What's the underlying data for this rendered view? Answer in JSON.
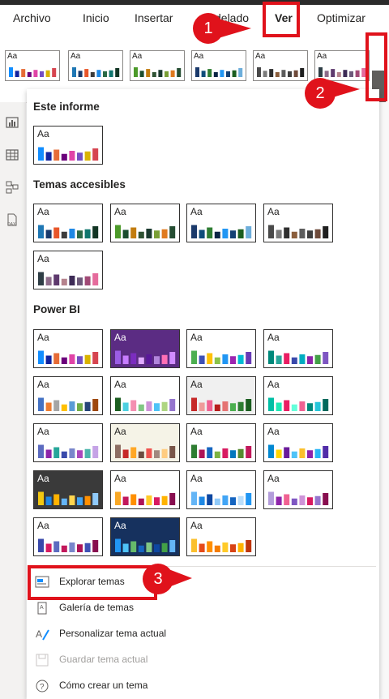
{
  "ribbon_tabs": [
    {
      "label": "Archivo"
    },
    {
      "label": "Inicio"
    },
    {
      "label": "Insertar"
    },
    {
      "label": "delado"
    },
    {
      "label": "Ver"
    },
    {
      "label": "Optimizar"
    }
  ],
  "theme_thumb_text": "Aa",
  "sections": {
    "este_informe": "Este informe",
    "temas_accesibles": "Temas accesibles",
    "power_bi": "Power BI"
  },
  "menu_items": [
    {
      "label": "Explorar temas",
      "icon": "browse-themes-icon",
      "enabled": true
    },
    {
      "label": "Galería de temas",
      "icon": "theme-gallery-icon",
      "enabled": true
    },
    {
      "label": "Personalizar tema actual",
      "icon": "customize-theme-icon",
      "enabled": true
    },
    {
      "label": "Guardar tema actual",
      "icon": "save-theme-icon",
      "enabled": false
    },
    {
      "label": "Cómo crear un tema",
      "icon": "help-icon",
      "enabled": true
    }
  ],
  "callouts": [
    "1",
    "2",
    "3"
  ],
  "colors": {
    "accent_tab": "#1b6e63",
    "callout_red": "#e0121b",
    "ribbon_dark": "#2b2b2b"
  },
  "themes": [
    {
      "group": "este_informe",
      "bg": "#ffffff",
      "dark": false,
      "bars": [
        "#118DFF",
        "#12239E",
        "#E66C37",
        "#6B007B",
        "#E044A7",
        "#744EC2",
        "#D9B300",
        "#D64550"
      ]
    },
    {
      "group": "accesibles",
      "bg": "#ffffff",
      "dark": false,
      "bars": [
        "#1F77B4",
        "#193A6C",
        "#E8562A",
        "#3C3C3C",
        "#1E88E5",
        "#2B6A47",
        "#0F766E",
        "#123524"
      ]
    },
    {
      "group": "accesibles",
      "bg": "#ffffff",
      "dark": false,
      "bars": [
        "#4C9A2A",
        "#1A4D2E",
        "#C27C0E",
        "#2F5233",
        "#1B3A2F",
        "#7A9F35",
        "#E07A1F",
        "#254D32"
      ]
    },
    {
      "group": "accesibles",
      "bg": "#ffffff",
      "dark": false,
      "bars": [
        "#1B3A6B",
        "#0E4C7A",
        "#2E7D32",
        "#0B2545",
        "#2196F3",
        "#134074",
        "#1B5E20",
        "#6DAEDB"
      ]
    },
    {
      "group": "accesibles",
      "bg": "#ffffff",
      "dark": false,
      "bars": [
        "#4A4A4A",
        "#7A7A7A",
        "#2F2F2F",
        "#8B5E3C",
        "#5C5C5C",
        "#3E3E3E",
        "#6E4A3A",
        "#1F1F1F"
      ]
    },
    {
      "group": "accesibles",
      "bg": "#ffffff",
      "dark": false,
      "bars": [
        "#2F3E46",
        "#8E6C8A",
        "#5E3A6E",
        "#B5838D",
        "#3D2B56",
        "#6D597A",
        "#A14A76",
        "#E56B9C"
      ]
    },
    {
      "group": "powerbi",
      "bg": "#ffffff",
      "dark": false,
      "bars": [
        "#118DFF",
        "#12239E",
        "#E66C37",
        "#6B007B",
        "#E044A7",
        "#744EC2",
        "#D9B300",
        "#D64550"
      ]
    },
    {
      "group": "powerbi",
      "bg": "#5b2c83",
      "dark": true,
      "bars": [
        "#9B5DE5",
        "#C77DFF",
        "#7B2CBF",
        "#E0AAFF",
        "#5A189A",
        "#B185DB",
        "#FF6FB5",
        "#D08CFF"
      ]
    },
    {
      "group": "powerbi",
      "bg": "#ffffff",
      "dark": false,
      "bars": [
        "#4CAF50",
        "#3F51B5",
        "#FFC107",
        "#8BC34A",
        "#2196F3",
        "#9C27B0",
        "#00BCD4",
        "#673AB7"
      ]
    },
    {
      "group": "powerbi",
      "bg": "#ffffff",
      "dark": false,
      "bars": [
        "#00897B",
        "#26A69A",
        "#E91E63",
        "#3949AB",
        "#00ACC1",
        "#8E24AA",
        "#43A047",
        "#7E57C2"
      ]
    },
    {
      "group": "powerbi",
      "bg": "#ffffff",
      "dark": false,
      "bars": [
        "#4472C4",
        "#ED7D31",
        "#A5A5A5",
        "#FFC000",
        "#5B9BD5",
        "#70AD47",
        "#264478",
        "#9E480E"
      ]
    },
    {
      "group": "powerbi",
      "bg": "#ffffff",
      "dark": false,
      "bars": [
        "#1B5E20",
        "#4DD0E1",
        "#F48FB1",
        "#81C784",
        "#CE93D8",
        "#4FC3F7",
        "#AED581",
        "#9575CD"
      ]
    },
    {
      "group": "powerbi",
      "bg": "#f0f0f0",
      "dark": false,
      "bars": [
        "#C62828",
        "#EF9A9A",
        "#F06292",
        "#B71C1C",
        "#E57373",
        "#4CAF50",
        "#2E7D32",
        "#1B5E20"
      ]
    },
    {
      "group": "powerbi",
      "bg": "#ffffff",
      "dark": false,
      "bars": [
        "#00BFA5",
        "#1DE9B6",
        "#E91E63",
        "#64FFDA",
        "#F06292",
        "#00897B",
        "#26C6DA",
        "#00695C"
      ]
    },
    {
      "group": "powerbi",
      "bg": "#ffffff",
      "dark": false,
      "bars": [
        "#5C6BC0",
        "#8E24AA",
        "#26A69A",
        "#3949AB",
        "#7986CB",
        "#AB47BC",
        "#4DB6AC",
        "#C5A3E6"
      ]
    },
    {
      "group": "powerbi",
      "bg": "#f5f3e7",
      "dark": false,
      "bars": [
        "#8D6E63",
        "#C62828",
        "#FFA726",
        "#6D4C41",
        "#EF5350",
        "#A1887F",
        "#FFCC80",
        "#795548"
      ]
    },
    {
      "group": "powerbi",
      "bg": "#ffffff",
      "dark": false,
      "bars": [
        "#2E7D32",
        "#AD1457",
        "#1565C0",
        "#7CB342",
        "#D81B60",
        "#0277BD",
        "#558B2F",
        "#C2185B"
      ]
    },
    {
      "group": "powerbi",
      "bg": "#ffffff",
      "dark": false,
      "bars": [
        "#0288D1",
        "#FFD600",
        "#6A1B9A",
        "#4FC3F7",
        "#FBC02D",
        "#8E24AA",
        "#29B6F6",
        "#512DA8"
      ]
    },
    {
      "group": "powerbi",
      "bg": "#3a3a3a",
      "dark": true,
      "bars": [
        "#F2C811",
        "#1E88E5",
        "#FFB300",
        "#64B5F6",
        "#FFD54F",
        "#42A5F5",
        "#FF8F00",
        "#90CAF9"
      ]
    },
    {
      "group": "powerbi",
      "bg": "#ffffff",
      "dark": false,
      "bars": [
        "#F9A825",
        "#C2185B",
        "#FF8F00",
        "#AD1457",
        "#FFCA28",
        "#D81B60",
        "#FFB300",
        "#880E4F"
      ]
    },
    {
      "group": "powerbi",
      "bg": "#ffffff",
      "dark": false,
      "bars": [
        "#64B5F6",
        "#1E88E5",
        "#0D47A1",
        "#90CAF9",
        "#42A5F5",
        "#1565C0",
        "#BBDEFB",
        "#2196F3"
      ]
    },
    {
      "group": "powerbi",
      "bg": "#ffffff",
      "dark": false,
      "bars": [
        "#B39DDB",
        "#8E24AA",
        "#F06292",
        "#7E57C2",
        "#CE93D8",
        "#D81B60",
        "#9575CD",
        "#880E4F"
      ]
    },
    {
      "group": "powerbi",
      "bg": "#ffffff",
      "dark": false,
      "bars": [
        "#3949AB",
        "#D81B60",
        "#5C6BC0",
        "#C2185B",
        "#7986CB",
        "#AD1457",
        "#3F51B5",
        "#880E4F"
      ]
    },
    {
      "group": "powerbi",
      "bg": "#16315e",
      "dark": true,
      "bars": [
        "#2196F3",
        "#4FC3F7",
        "#66BB6A",
        "#1565C0",
        "#81C784",
        "#0D47A1",
        "#43A047",
        "#64B5F6"
      ]
    },
    {
      "group": "powerbi",
      "bg": "#ffffff",
      "dark": false,
      "bars": [
        "#FBC02D",
        "#E64A19",
        "#FF8F00",
        "#F57C00",
        "#FFCA28",
        "#D84315",
        "#FFB300",
        "#BF360C"
      ]
    }
  ],
  "ribbon_themes": [
    {
      "bars": [
        "#118DFF",
        "#12239E",
        "#E66C37",
        "#6B007B",
        "#E044A7",
        "#744EC2",
        "#D9B300",
        "#D64550"
      ]
    },
    {
      "bars": [
        "#1F77B4",
        "#193A6C",
        "#E8562A",
        "#3C3C3C",
        "#1E88E5",
        "#2B6A47",
        "#0F766E",
        "#123524"
      ]
    },
    {
      "bars": [
        "#4C9A2A",
        "#1A4D2E",
        "#C27C0E",
        "#2F5233",
        "#1B3A2F",
        "#7A9F35",
        "#E07A1F",
        "#254D32"
      ]
    },
    {
      "bars": [
        "#1B3A6B",
        "#0E4C7A",
        "#2E7D32",
        "#0B2545",
        "#2196F3",
        "#134074",
        "#1B5E20",
        "#6DAEDB"
      ]
    },
    {
      "bars": [
        "#4A4A4A",
        "#7A7A7A",
        "#2F2F2F",
        "#8B5E3C",
        "#5C5C5C",
        "#3E3E3E",
        "#6E4A3A",
        "#1F1F1F"
      ]
    },
    {
      "bars": [
        "#2F3E46",
        "#8E6C8A",
        "#5E3A6E",
        "#B5838D",
        "#3D2B56",
        "#6D597A",
        "#A14A76",
        "#E56B9C"
      ]
    }
  ]
}
